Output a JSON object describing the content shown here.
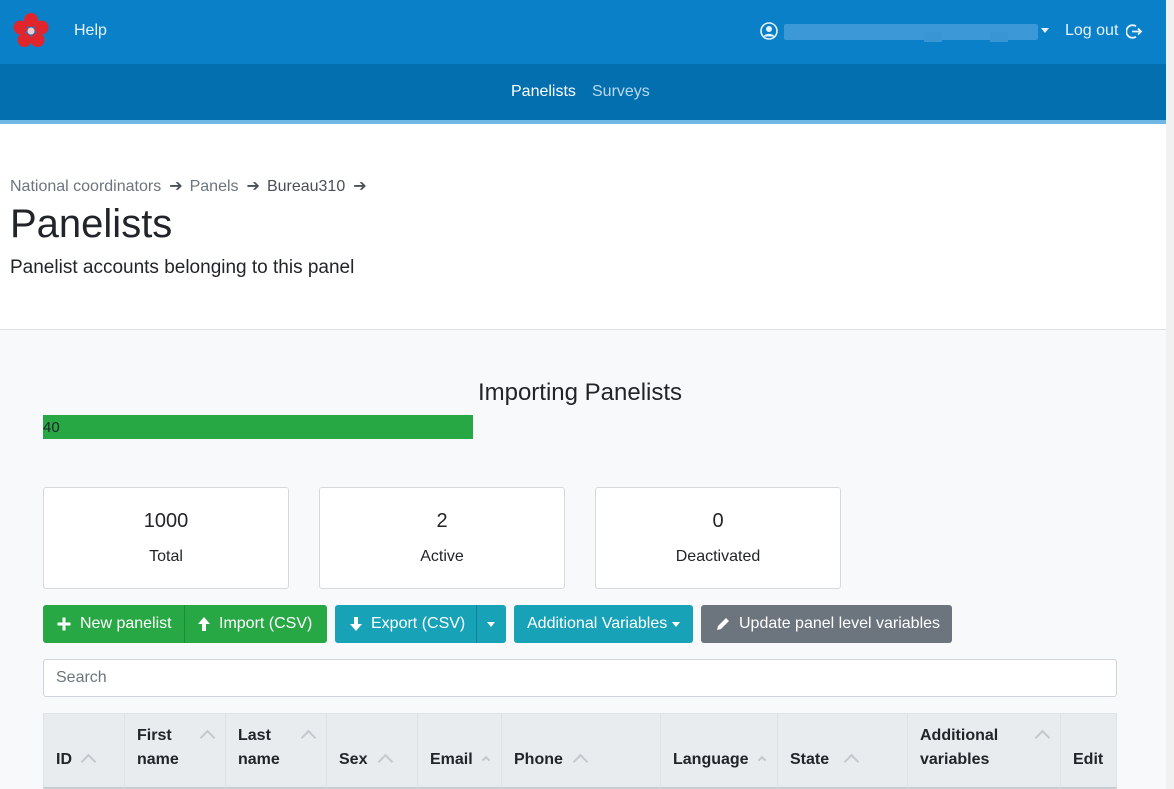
{
  "topbar": {
    "help_label": "Help",
    "logout_label": "Log out",
    "brand_color": "#0a80c8"
  },
  "subnav": {
    "items": [
      {
        "label": "Panelists",
        "active": true
      },
      {
        "label": "Surveys",
        "active": false
      }
    ]
  },
  "breadcrumb": {
    "items": [
      "National coordinators",
      "Panels",
      "Bureau310"
    ],
    "separator": "➔"
  },
  "page": {
    "title": "Panelists",
    "subtitle": "Panelist accounts belonging to this panel"
  },
  "import": {
    "title": "Importing Panelists",
    "progress_percent": 40,
    "progress_label": "40",
    "color": "#28a745"
  },
  "stats": [
    {
      "value": "1000",
      "label": "Total"
    },
    {
      "value": "2",
      "label": "Active"
    },
    {
      "value": "0",
      "label": "Deactivated"
    }
  ],
  "actions": {
    "new_panelist": "New panelist",
    "import_csv": "Import (CSV)",
    "export_csv": "Export (CSV)",
    "additional_variables": "Additional Variables",
    "update_panel_vars": "Update panel level variables"
  },
  "search": {
    "placeholder": "Search",
    "value": ""
  },
  "table": {
    "columns": [
      {
        "line1": "",
        "line2": "ID"
      },
      {
        "line1": "First",
        "line2": "name"
      },
      {
        "line1": "Last",
        "line2": "name"
      },
      {
        "line1": "",
        "line2": "Sex"
      },
      {
        "line1": "",
        "line2": "Email"
      },
      {
        "line1": "",
        "line2": "Phone"
      },
      {
        "line1": "",
        "line2": "Language"
      },
      {
        "line1": "",
        "line2": "State"
      },
      {
        "line1": "Additional",
        "line2": "variables"
      },
      {
        "line1": "",
        "line2": "Edit"
      }
    ]
  }
}
